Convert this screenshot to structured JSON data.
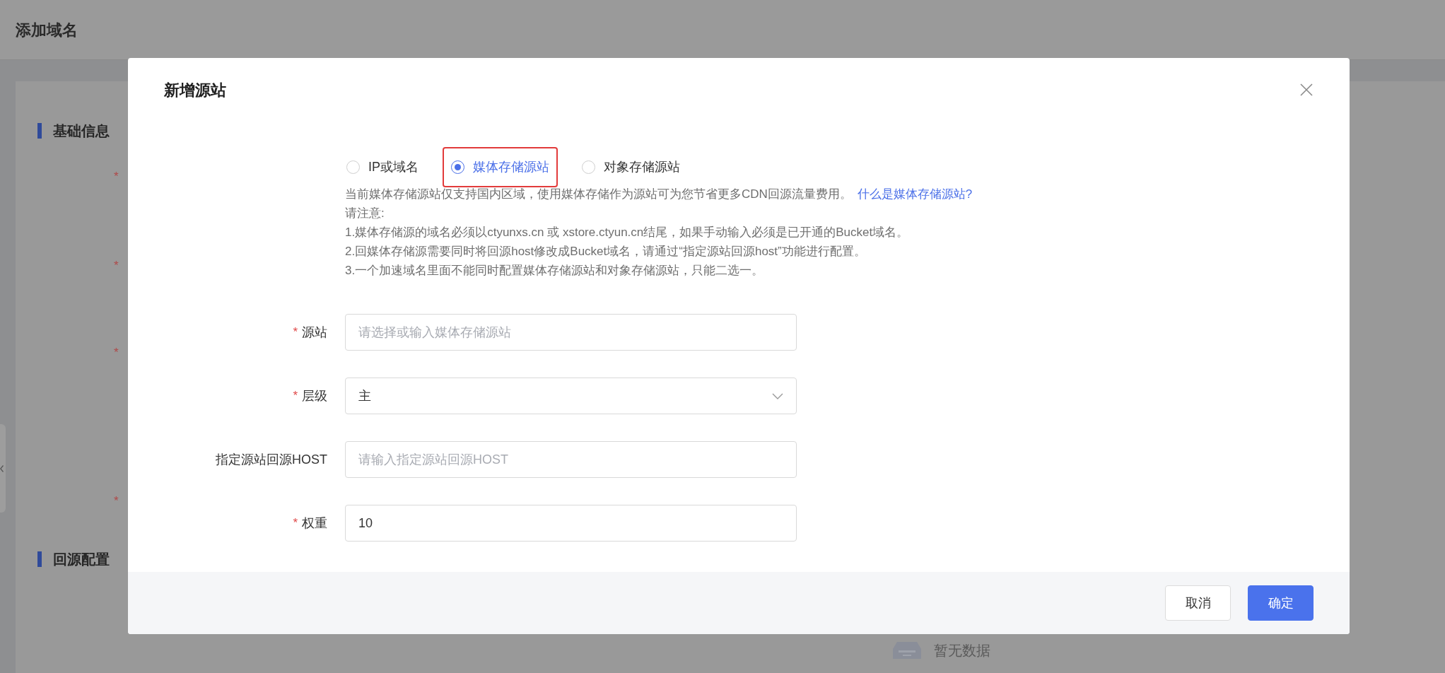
{
  "page": {
    "title": "添加域名",
    "sections": [
      {
        "title": "基础信息",
        "required_marks": [
          "*",
          "*",
          "*",
          "*"
        ]
      },
      {
        "title": "回源配置"
      }
    ],
    "empty_state": "暂无数据"
  },
  "dialog": {
    "title": "新增源站",
    "origin_types": [
      {
        "label": "IP或域名",
        "selected": false,
        "highlighted": false
      },
      {
        "label": "媒体存储源站",
        "selected": true,
        "highlighted": true
      },
      {
        "label": "对象存储源站",
        "selected": false,
        "highlighted": false
      }
    ],
    "notice": {
      "intro": "当前媒体存储源站仅支持国内区域，使用媒体存储作为源站可为您节省更多CDN回源流量费用。",
      "link": "什么是媒体存储源站?",
      "lines": [
        "请注意:",
        "1.媒体存储源的域名必须以ctyunxs.cn 或 xstore.ctyun.cn结尾，如果手动输入必须是已开通的Bucket域名。",
        "2.回媒体存储源需要同时将回源host修改成Bucket域名，请通过“指定源站回源host”功能进行配置。",
        "3.一个加速域名里面不能同时配置媒体存储源站和对象存储源站，只能二选一。"
      ]
    },
    "fields": [
      {
        "label": "源站",
        "required": true,
        "kind": "input",
        "placeholder": "请选择或输入媒体存储源站"
      },
      {
        "label": "层级",
        "required": true,
        "kind": "select",
        "value": "主"
      },
      {
        "label": "指定源站回源HOST",
        "required": false,
        "kind": "input",
        "placeholder": "请输入指定源站回源HOST"
      },
      {
        "label": "权重",
        "required": true,
        "kind": "input",
        "value": "10"
      }
    ],
    "buttons": [
      {
        "label": "取消",
        "kind": "default"
      },
      {
        "label": "确定",
        "kind": "primary"
      }
    ]
  }
}
